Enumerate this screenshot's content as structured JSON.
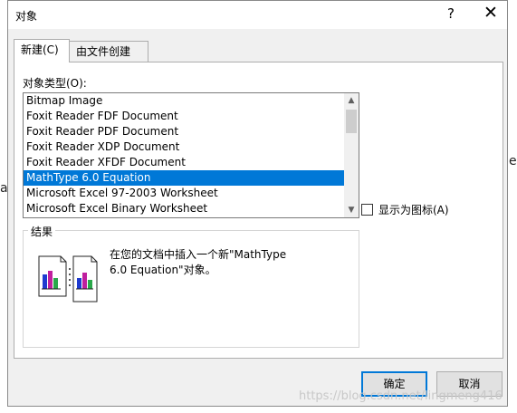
{
  "background": {
    "left_char": "a",
    "right_char": "e"
  },
  "dialog": {
    "title": "对象",
    "help_glyph": "?",
    "close_glyph": "✕"
  },
  "tabs": [
    {
      "label": "新建(C)",
      "active": true
    },
    {
      "label": "由文件创建(F)",
      "active": false
    }
  ],
  "object_type_label": "对象类型(O):",
  "object_types": [
    {
      "label": "Bitmap Image",
      "selected": false
    },
    {
      "label": "Foxit Reader FDF Document",
      "selected": false
    },
    {
      "label": "Foxit Reader PDF Document",
      "selected": false
    },
    {
      "label": "Foxit Reader XDP Document",
      "selected": false
    },
    {
      "label": "Foxit Reader XFDF Document",
      "selected": false
    },
    {
      "label": "MathType 6.0 Equation",
      "selected": true
    },
    {
      "label": "Microsoft Excel 97-2003 Worksheet",
      "selected": false
    },
    {
      "label": "Microsoft Excel Binary Worksheet",
      "selected": false
    }
  ],
  "display_as_icon": {
    "label": "显示为图标(A)",
    "checked": false
  },
  "result": {
    "legend": "结果",
    "line1": "在您的文档中插入一个新\"MathType",
    "line2": "6.0 Equation\"对象。"
  },
  "buttons": {
    "ok": "确定",
    "cancel": "取消"
  },
  "watermark": "https://blog.csdn.net/lingmeng416",
  "colors": {
    "selection": "#0078d7",
    "dialog_bg": "#f0f0f0",
    "panel_bg": "#ffffff"
  }
}
